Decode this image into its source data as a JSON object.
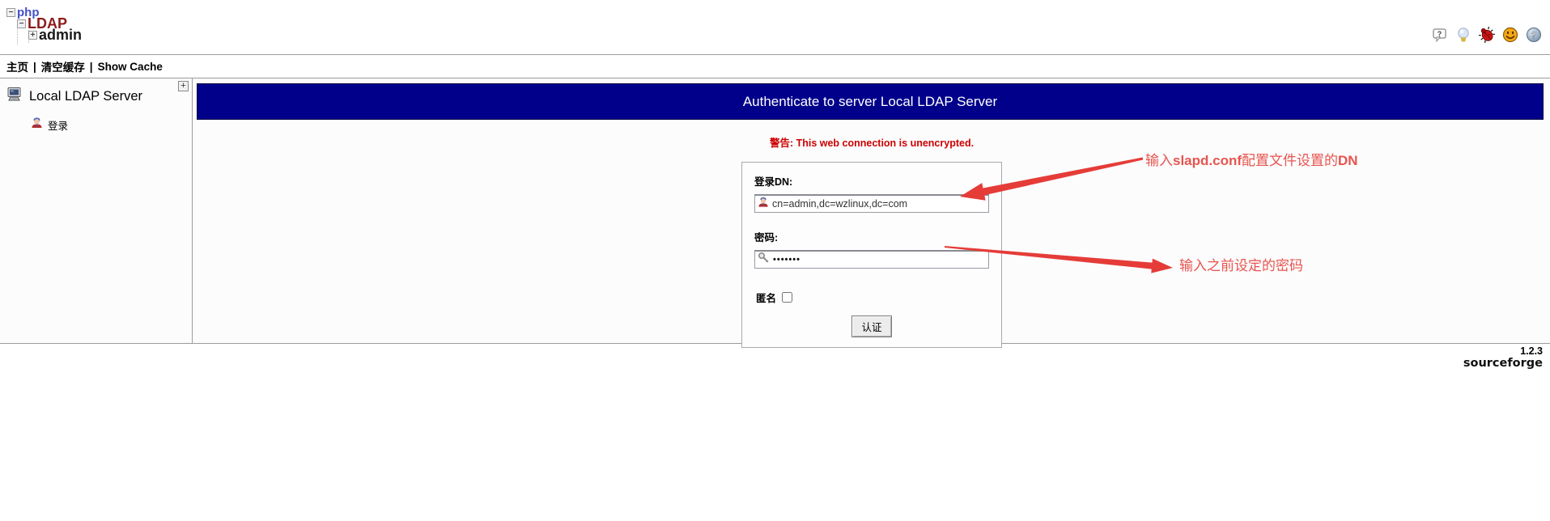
{
  "colors": {
    "title_bg": "#00008b",
    "title_text": "#ffffff",
    "warning_red": "#cc0000",
    "annotation_red": "#e8544e",
    "arrow_red": "#e53c38",
    "logo_php_blue": "#4450c8",
    "logo_ldap_red": "#8c1b1b",
    "logo_admin_black": "#1a1a1a"
  },
  "logo": {
    "php": "php",
    "ldap": "LDAP",
    "admin": "admin",
    "tree_minus": "−",
    "tree_plus": "+"
  },
  "header_icons": [
    {
      "name": "help-bubble-icon"
    },
    {
      "name": "light-bulb-icon"
    },
    {
      "name": "bug-report-icon"
    },
    {
      "name": "smiley-donate-icon"
    },
    {
      "name": "help-globe-icon"
    }
  ],
  "navbar": {
    "items": [
      "主页",
      "清空缓存",
      "Show Cache"
    ],
    "separator": "|"
  },
  "sidebar": {
    "expand_icon": "+",
    "server_name": "Local LDAP Server",
    "login_label": "登录"
  },
  "main": {
    "title": "Authenticate to server Local LDAP Server",
    "warning": "警告: This web connection is unencrypted.",
    "form": {
      "dn_label": "登录DN:",
      "dn_value": "cn=admin,dc=wzlinux,dc=com",
      "password_label": "密码:",
      "password_value": "•••••••",
      "anonymous_label": "匿名",
      "anonymous_checked": false,
      "submit_label": "认证"
    },
    "annotations": {
      "dn": {
        "p1": "输入",
        "b1": "slapd.conf",
        "p2": "配置文件设置的",
        "b2": "DN"
      },
      "pw": {
        "text": "输入之前设定的密码"
      }
    }
  },
  "footer": {
    "version": "1.2.3",
    "brand": "sourceforge"
  }
}
